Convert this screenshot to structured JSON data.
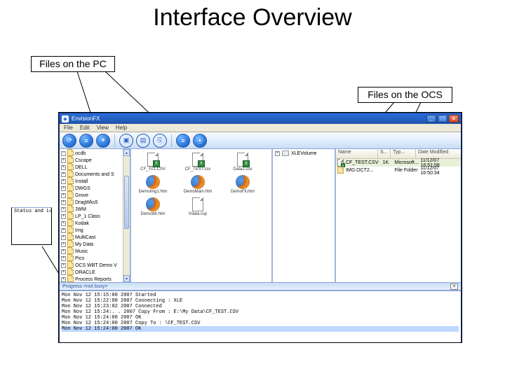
{
  "slide": {
    "title": "Interface Overview",
    "callout_pc": "Files on the PC",
    "callout_ocs": "Files on the OCS",
    "callout_log": "Status and Log"
  },
  "window": {
    "title": "EnvisionFX",
    "menu": [
      "File",
      "Edit",
      "View",
      "Help"
    ]
  },
  "tree": {
    "items": [
      "ocdb",
      "Cscape",
      "DELL",
      "Documents and S",
      "Install",
      "DWGS",
      "Grove",
      "DragWks5",
      "JWM",
      "LP_1 Class",
      "Kodak",
      "Img",
      "MultiCast",
      "My Data",
      "Music",
      "Pics",
      "OCS WBT Demo V",
      "ORACLE",
      "Process Reports"
    ]
  },
  "pc_files": {
    "csv1": "CF_T01.CSV",
    "csv2": "CF_TEST.csv",
    "csv3": "Data2.csv",
    "htm1": "DemoImg1.htm",
    "htm2": "DemoMain.htm",
    "htm3": "DemoFil.htm",
    "htm4": "DemoWr.htm",
    "csp1": "Vdata.csp"
  },
  "ocs_path": {
    "drive": "XLEVolume"
  },
  "ocs_list": {
    "headers": {
      "name": "Name",
      "size": "S...",
      "type": "Typ...",
      "date": "Date Modified"
    },
    "rows": [
      {
        "name": "CF_TEST.CSV",
        "size": "1K",
        "type": "Microsoft...",
        "date": "11/12/07 16:51:58"
      },
      {
        "name": "IMG.OCT2...",
        "size": "",
        "type": "File Folder",
        "date": "11/12/07 16:50:34"
      }
    ]
  },
  "progress": {
    "label": "Progress  <not busy>"
  },
  "log": {
    "lines": [
      "Mon Nov 12 15:15:00 2007 Started",
      "Mon Nov 12 15:22:00 2007 Connecting : XLE",
      "Mon Nov 12 15:23:02 2007 Connected",
      "Mon Nov 12 15:24:. . 2007 Copy From : E:\\My Data\\CF_TEST.CSV",
      "Mon Nov 12 15:24:00 2007 OK",
      "Mon Nov 12 15:24:00 2007 Copy To  : \\CF_TEST.CSV",
      "Mon Nov 12 15:24:00 2007 OK"
    ]
  }
}
